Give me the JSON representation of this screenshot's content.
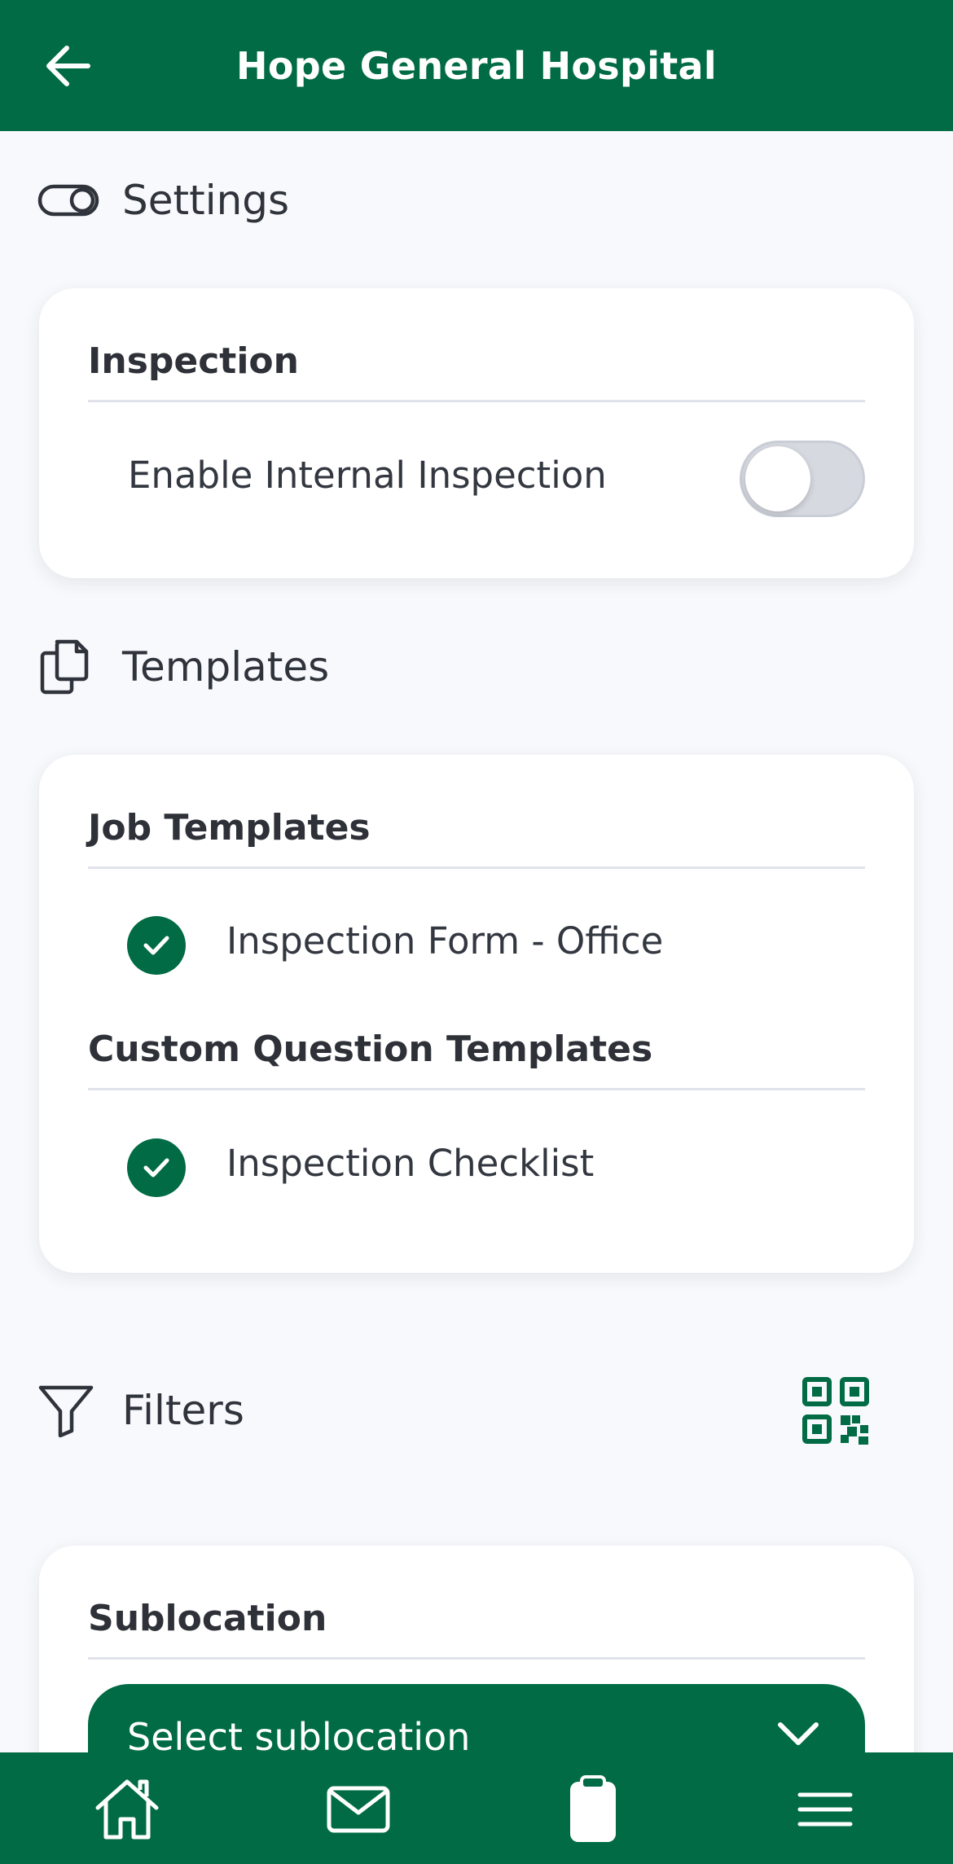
{
  "header": {
    "title": "Hope General Hospital",
    "back_icon": "arrow-left-icon"
  },
  "settings": {
    "section_label": "Settings",
    "icon": "toggle-icon",
    "card": {
      "title": "Inspection",
      "enable_internal_inspection": {
        "label": "Enable Internal Inspection",
        "enabled": false
      }
    }
  },
  "templates": {
    "section_label": "Templates",
    "icon": "documents-icon",
    "job_templates": {
      "title": "Job Templates",
      "items": [
        {
          "label": "Inspection Form - Office",
          "checked": true
        }
      ]
    },
    "custom_question_templates": {
      "title": "Custom Question Templates",
      "items": [
        {
          "label": "Inspection Checklist",
          "checked": true
        }
      ]
    }
  },
  "filters": {
    "section_label": "Filters",
    "icon": "filter-icon",
    "qr_icon": "qr-code-icon",
    "sublocation": {
      "title": "Sublocation",
      "select_placeholder": "Select sublocation"
    }
  },
  "bottom_nav": {
    "items": [
      {
        "name": "home",
        "icon": "home-icon"
      },
      {
        "name": "messages",
        "icon": "mail-icon"
      },
      {
        "name": "jobs",
        "icon": "clipboard-icon"
      },
      {
        "name": "menu",
        "icon": "menu-icon"
      }
    ]
  },
  "colors": {
    "brand": "#006b45",
    "background": "#f8f9fc",
    "card": "#ffffff",
    "toggle_off": "#d6d9e0"
  }
}
